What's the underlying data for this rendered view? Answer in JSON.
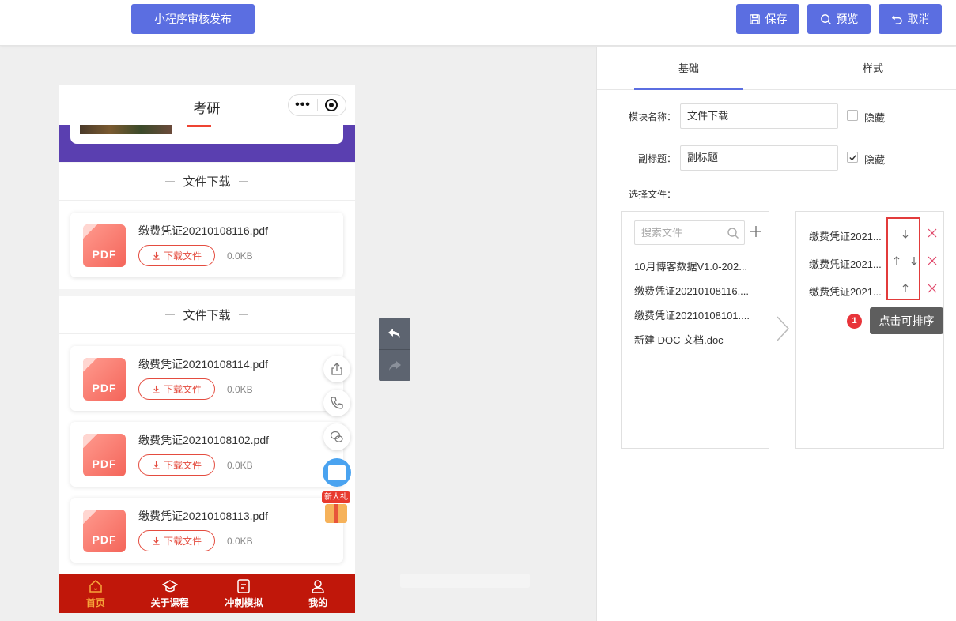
{
  "topbar": {
    "publish_label": "小程序审核发布",
    "save_label": "保存",
    "preview_label": "预览",
    "cancel_label": "取消"
  },
  "phone": {
    "title": "考研",
    "capsule_dots": "•••",
    "sections": [
      {
        "title": "文件下载",
        "files": [
          {
            "name": "缴费凭证20210108116.pdf",
            "download_label": "下载文件",
            "size": "0.0KB",
            "icon_text": "PDF"
          }
        ]
      },
      {
        "title": "文件下载",
        "files": [
          {
            "name": "缴费凭证20210108114.pdf",
            "download_label": "下载文件",
            "size": "0.0KB",
            "icon_text": "PDF"
          },
          {
            "name": "缴费凭证20210108102.pdf",
            "download_label": "下载文件",
            "size": "0.0KB",
            "icon_text": "PDF"
          },
          {
            "name": "缴费凭证20210108113.pdf",
            "download_label": "下载文件",
            "size": "0.0KB",
            "icon_text": "PDF"
          }
        ]
      }
    ],
    "gift_label": "新人礼",
    "tabs": [
      {
        "label": "首页",
        "icon": "home-icon"
      },
      {
        "label": "关于课程",
        "icon": "graduation-cap-icon"
      },
      {
        "label": "冲刺模拟",
        "icon": "exam-icon"
      },
      {
        "label": "我的",
        "icon": "user-icon"
      }
    ]
  },
  "panel": {
    "tabs": [
      "基础",
      "样式"
    ],
    "module_name_label": "模块名称：",
    "module_name_value": "文件下载",
    "subtitle_label": "副标题：",
    "subtitle_value": "副标题",
    "hide_label": "隐藏",
    "module_hidden": false,
    "subtitle_hidden": true,
    "choose_file_label": "选择文件：",
    "search_placeholder": "搜索文件",
    "available_files": [
      "10月博客数据V1.0-202...",
      "缴费凭证20210108116....",
      "缴费凭证20210108101....",
      "新建 DOC 文档.doc"
    ],
    "selected_files": [
      "缴费凭证2021...",
      "缴费凭证2021...",
      "缴费凭证2021..."
    ],
    "badge_number": "1",
    "tooltip": "点击可排序"
  },
  "colors": {
    "accent": "#5b6ee1",
    "tabbar": "#c0170a",
    "tab_active": "#f7a63a",
    "download": "#e44c3f",
    "highlight_red": "#e23b3b"
  }
}
